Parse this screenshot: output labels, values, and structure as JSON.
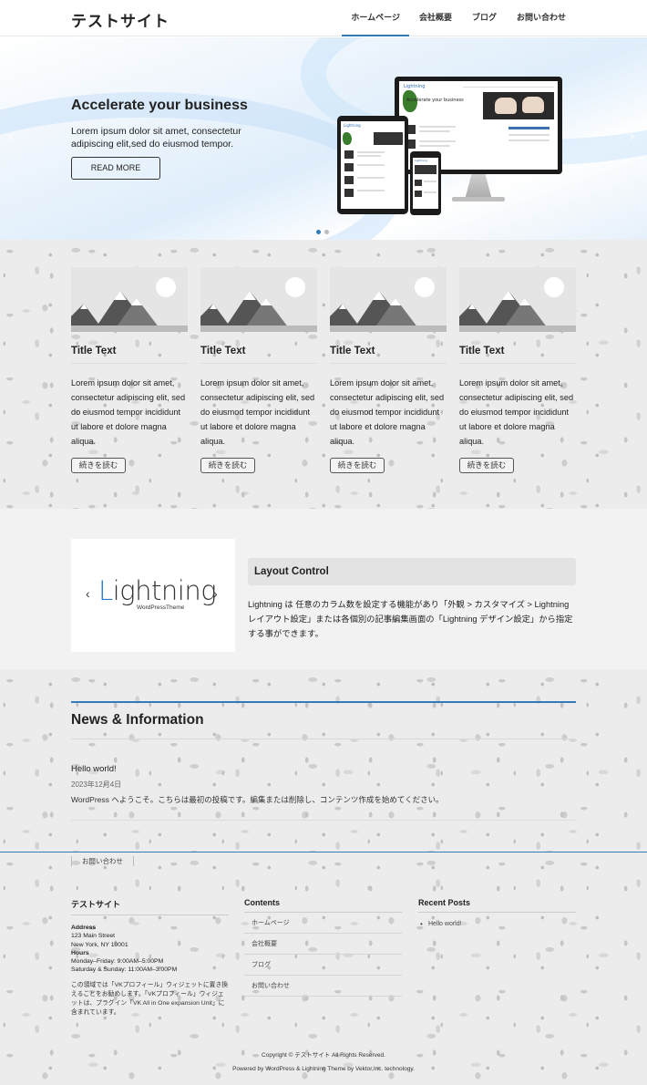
{
  "header": {
    "site_title": "テストサイト",
    "nav": [
      "ホームページ",
      "会社概要",
      "ブログ",
      "お問い合わせ"
    ],
    "active_index": 0
  },
  "slider": {
    "title": "Accelerate your business",
    "text": "Lorem ipsum dolor sit amet, consectetur adipiscing elit,sed do eiusmod tempor.",
    "button_label": "READ MORE",
    "prev_glyph": "‹",
    "next_glyph": "›",
    "slide_count": 2,
    "active_slide": 0,
    "mockup_logo": "Lightning",
    "mockup_headline": "Accelerate your business"
  },
  "cards": [
    {
      "title": "Title Text",
      "text": "Lorem ipsum dolor sit amet, consectetur adipiscing elit, sed do eiusmod tempor incididunt ut labore et dolore magna aliqua.",
      "button_label": "続きを読む",
      "image_icon": "placeholder-image-icon"
    },
    {
      "title": "Title Text",
      "text": "Lorem ipsum dolor sit amet, consectetur adipiscing elit, sed do eiusmod tempor incididunt ut labore et dolore magna aliqua.",
      "button_label": "続きを読む",
      "image_icon": "placeholder-image-icon"
    },
    {
      "title": "Title Text",
      "text": "Lorem ipsum dolor sit amet, consectetur adipiscing elit, sed do eiusmod tempor incididunt ut labore et dolore magna aliqua.",
      "button_label": "続きを読む",
      "image_icon": "placeholder-image-icon"
    },
    {
      "title": "Title Text",
      "text": "Lorem ipsum dolor sit amet, consectetur adipiscing elit, sed do eiusmod tempor incididunt ut labore et dolore magna aliqua.",
      "button_label": "続きを読む",
      "image_icon": "placeholder-image-icon"
    }
  ],
  "layout_control": {
    "logo_left_bracket": "‹",
    "logo_right_bracket": "›",
    "logo_letter": "L",
    "logo_rest": "ightning",
    "logo_sub": "WordPressTheme",
    "title": "Layout Control",
    "text": "Lightning は 任意のカラム数を設定する機能があり「外観 > カスタマイズ > Lightning レイアウト設定」または各個別の記事編集画面の「Lightning デザイン設定」から指定する事ができます。"
  },
  "news": {
    "title": "News & Information",
    "post_title": "Hello world!",
    "post_date": "2023年12月4日",
    "post_excerpt": "WordPress へようこそ。こちらは最初の投稿です。編集または削除し、コンテンツ作成を始めてください。"
  },
  "footer": {
    "nav_item": "お問い合わせ",
    "col1": {
      "title": "テストサイト",
      "address_label": "Address",
      "address_line1": "123 Main Street",
      "address_line2": "New York, NY 10001",
      "hours_label": "Hours",
      "hours_line1": "Monday–Friday: 9:00AM–5:00PM",
      "hours_line2": "Saturday & Sunday: 11:00AM–3:00PM",
      "note": "この領域では「VKプロフィール」ウィジェットに置き換えることをお勧めします。「VKプロフィール」ウィジェットは、プラグイン「VK All in One expansion Unit」に含まれています。"
    },
    "col2": {
      "title": "Contents",
      "items": [
        "ホームページ",
        "会社概要",
        "ブログ",
        "お問い合わせ"
      ]
    },
    "col3": {
      "title": "Recent Posts",
      "items": [
        "Hello world!"
      ]
    },
    "copyright": "Copyright © テストサイト All Rights Reserved.",
    "powered": "Powered by WordPress & Lightning Theme by Vektor,Inc. technology."
  },
  "colors": {
    "accent": "#337ab7",
    "text": "#222222",
    "section_gray": "#f2f2f2"
  }
}
